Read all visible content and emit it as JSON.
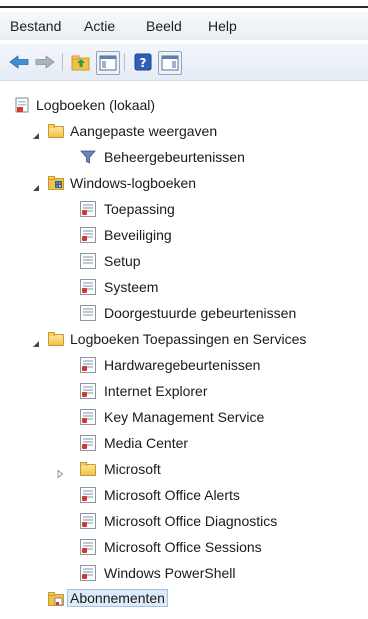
{
  "menu": {
    "items": [
      "Bestand",
      "Actie",
      "Beeld",
      "Help"
    ]
  },
  "toolbar": {
    "buttons": [
      "back-arrow-icon",
      "forward-arrow-icon",
      "folder-up-icon",
      "show-hide-console-tree-icon",
      "help-icon",
      "show-hide-action-pane-icon"
    ]
  },
  "tree": {
    "root": "Logboeken (lokaal)",
    "custom_views": "Aangepaste weergaven",
    "admin_events": "Beheergebeurtenissen",
    "windows_logs": "Windows-logboeken",
    "application": "Toepassing",
    "security": "Beveiliging",
    "setup": "Setup",
    "system": "Systeem",
    "forwarded": "Doorgestuurde gebeurtenissen",
    "apps_services": "Logboeken Toepassingen en Services",
    "hardware": "Hardwaregebeurtenissen",
    "ie": "Internet Explorer",
    "kms": "Key Management Service",
    "media_center": "Media Center",
    "microsoft": "Microsoft",
    "office_alerts": "Microsoft Office Alerts",
    "office_diagnostics": "Microsoft Office Diagnostics",
    "office_sessions": "Microsoft Office Sessions",
    "powershell": "Windows PowerShell",
    "subscriptions": "Abonnementen"
  }
}
